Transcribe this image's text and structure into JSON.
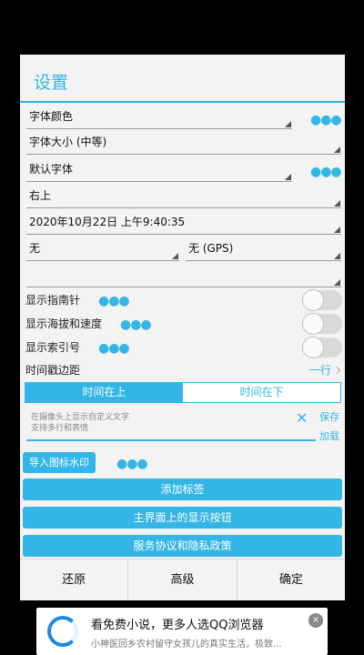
{
  "dialog": {
    "title": "设置",
    "spinners": [
      "字体颜色",
      "字体大小 (中等)",
      "默认字体",
      "右上",
      "2020年10月22日 上午9:40:35",
      "无",
      "无 (GPS)",
      ""
    ],
    "more_dots": "●●●",
    "options": [
      "显示指南针",
      "显示海拔和速度",
      "显示索引号"
    ],
    "timestamp_margin_label": "时间戳边距",
    "timestamp_margin_value": "一行",
    "segment": {
      "top": "时间在上",
      "bottom": "时间在下",
      "selected": "时间在上"
    },
    "custom_text": {
      "placeholder_line1": "在摄像头上显示自定义文字",
      "placeholder_line2": "支持多行和表情",
      "clear": "✕",
      "save": "保存",
      "load": "加载"
    },
    "import_watermark": "导入图标水印",
    "buttons": [
      "添加标签",
      "主界面上的显示按钮",
      "服务协议和隐私政策"
    ],
    "footer": {
      "reset": "还原",
      "advanced": "高级",
      "ok": "确定"
    }
  },
  "ad": {
    "title": "看免费小说，更多人选QQ浏览器",
    "subtitle": "小神医回乡农村留守女孩儿的真实生活，极致...",
    "close": "×",
    "logo_icon": "qq-browser-logo"
  },
  "colors": {
    "accent": "#33b5e5",
    "dialog_bg": "#f3f3f3",
    "background": "#000000"
  }
}
